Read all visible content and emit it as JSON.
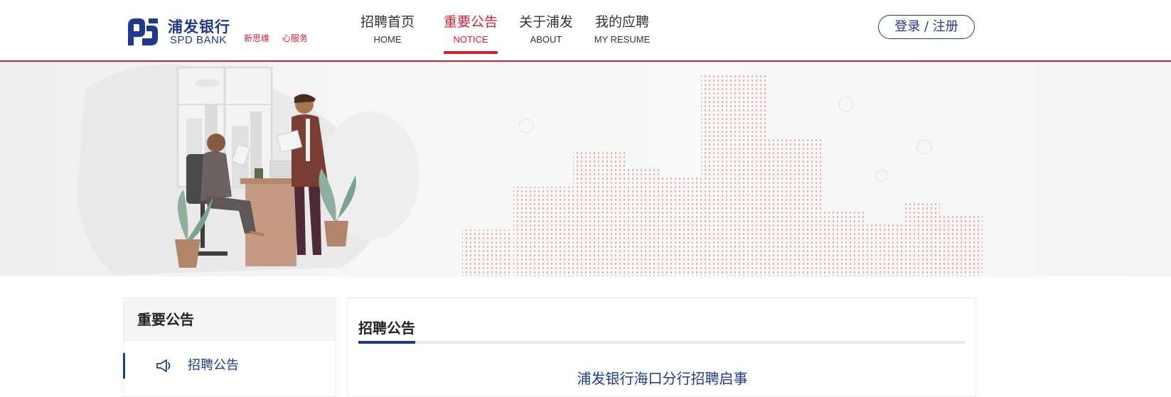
{
  "brand": {
    "name_cn": "浦发银行",
    "name_en": "SPD BANK",
    "slogan": "新思维 心服务",
    "colors": {
      "primary": "#1f3a8a",
      "accent": "#d71f34"
    }
  },
  "nav": {
    "items": [
      {
        "cn": "招聘首页",
        "en": "HOME"
      },
      {
        "cn": "重要公告",
        "en": "NOTICE",
        "active": true
      },
      {
        "cn": "关于浦发",
        "en": "ABOUT"
      },
      {
        "cn": "我的应聘",
        "en": "MY RESUME"
      }
    ]
  },
  "header": {
    "login_label": "登录 / 注册"
  },
  "sidebar": {
    "title": "重要公告",
    "items": [
      {
        "label": "招聘公告",
        "icon": "megaphone-icon"
      }
    ]
  },
  "main": {
    "tab_label": "招聘公告",
    "articles": [
      {
        "title": "浦发银行海口分行招聘启事"
      }
    ]
  }
}
